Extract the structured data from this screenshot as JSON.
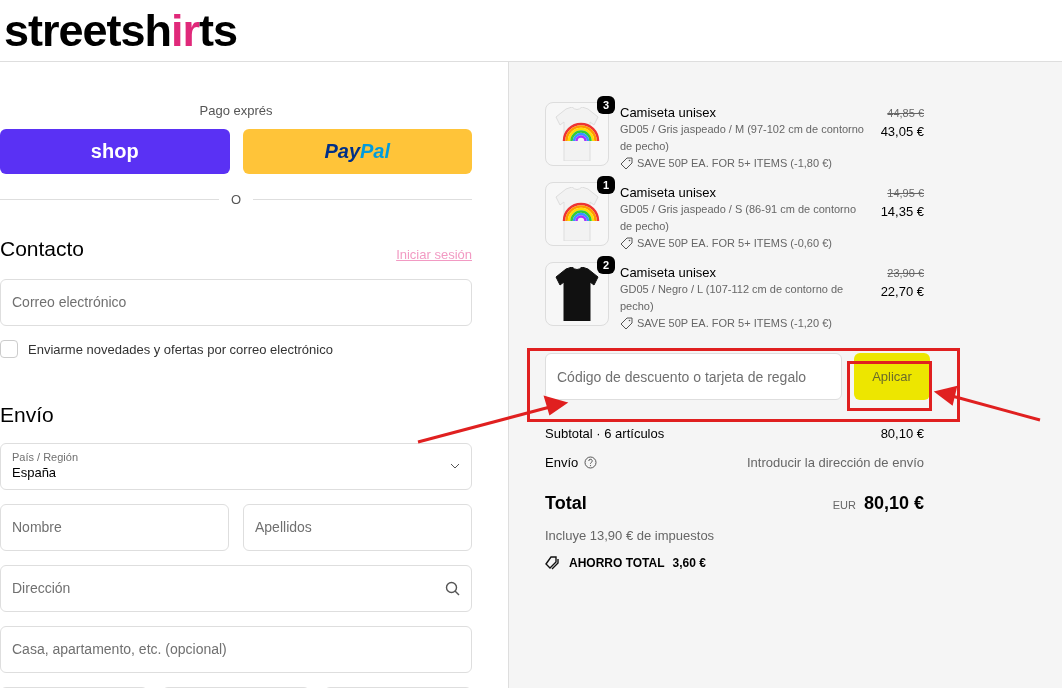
{
  "logo": [
    {
      "text": "streetsh",
      "accent": false
    },
    {
      "text": "ir",
      "accent": true
    },
    {
      "text": "ts",
      "accent": false
    }
  ],
  "express": {
    "title": "Pago exprés",
    "buttons": [
      {
        "kind": "shop",
        "label": "shop"
      },
      {
        "kind": "paypal",
        "label": "Pay",
        "label2": "Pal"
      }
    ],
    "divider": "O"
  },
  "contact": {
    "title": "Contacto",
    "login_link": "Iniciar sesión",
    "email": {
      "placeholder": "Correo electrónico"
    },
    "newsletter": {
      "label": "Enviarme novedades y ofertas por correo electrónico",
      "checked": false
    }
  },
  "shipping": {
    "title": "Envío",
    "country": {
      "label": "País / Región",
      "value": "España"
    },
    "first_name": {
      "placeholder": "Nombre"
    },
    "last_name": {
      "placeholder": "Apellidos"
    },
    "address": {
      "placeholder": "Dirección"
    },
    "apartment": {
      "placeholder": "Casa, apartamento, etc. (opcional)"
    }
  },
  "items": [
    {
      "quantity": "3",
      "name": "Camiseta unisex",
      "variant": "GD05 / Gris jaspeado / M (97-102 cm de contorno de pecho)",
      "discount": "SAVE 50P EA. FOR 5+ ITEMS (-1,80 €)",
      "old_price": "44,85 €",
      "price": "43,05 €",
      "kind": "rainbow"
    },
    {
      "quantity": "1",
      "name": "Camiseta unisex",
      "variant": "GD05 / Gris jaspeado / S (86-91 cm de contorno de pecho)",
      "discount": "SAVE 50P EA. FOR 5+ ITEMS (-0,60 €)",
      "old_price": "14,95 €",
      "price": "14,35 €",
      "kind": "rainbow"
    },
    {
      "quantity": "2",
      "name": "Camiseta unisex",
      "variant": "GD05 / Negro / L (107-112 cm de contorno de pecho)",
      "discount": "SAVE 50P EA. FOR 5+ ITEMS (-1,20 €)",
      "old_price": "23,90 €",
      "price": "22,70 €",
      "kind": "black"
    }
  ],
  "discount": {
    "placeholder": "Código de descuento o tarjeta de regalo",
    "button": "Aplicar"
  },
  "summary": {
    "subtotal_label": "Subtotal · 6 artículos",
    "subtotal": "80,10 €",
    "shipping_label": "Envío",
    "shipping_value": "Introducir la dirección de envío",
    "total_label": "Total",
    "currency": "EUR",
    "total": "80,10 €",
    "taxes": "Incluye 13,90 € de impuestos",
    "savings_label": "AHORRO TOTAL",
    "savings": "3,60 €"
  }
}
